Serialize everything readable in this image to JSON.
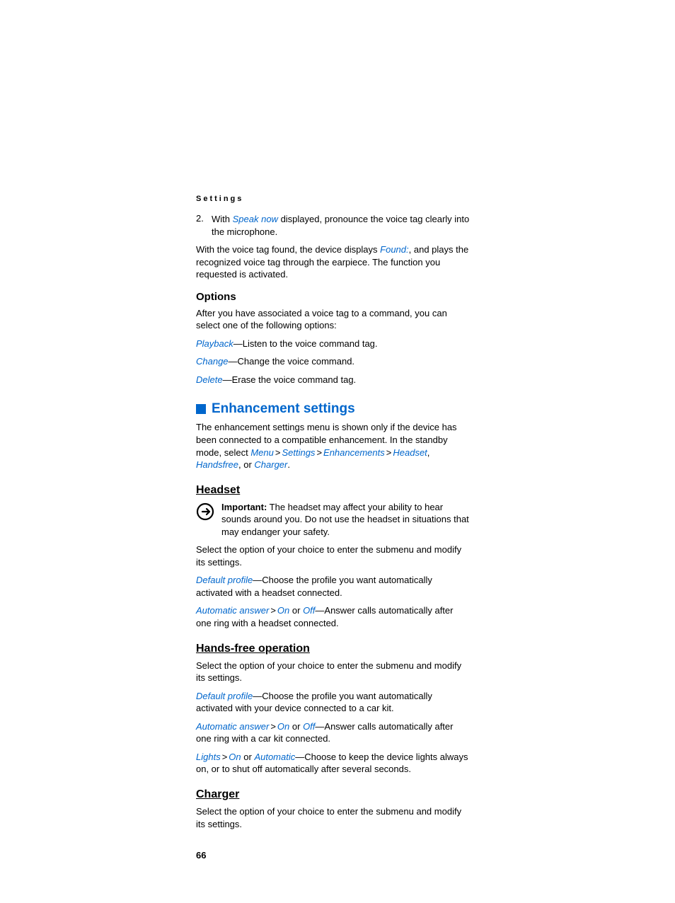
{
  "runhead": "Settings",
  "step2": {
    "num": "2.",
    "t1": "With ",
    "speak_now": "Speak now",
    "t2": " displayed, pronounce the voice tag clearly into the microphone."
  },
  "para_found": {
    "t1": "With the voice tag found, the device displays ",
    "found": "Found:",
    "t2": ", and plays the recognized voice tag through the earpiece. The function you requested is activated."
  },
  "options_h": "Options",
  "options_intro": "After you have associated a voice tag to a command, you can select one of the following options:",
  "opt_playback": {
    "term": "Playback",
    "desc": "—Listen to the voice command tag."
  },
  "opt_change": {
    "term": "Change",
    "desc": "—Change the voice command."
  },
  "opt_delete": {
    "term": "Delete",
    "desc": "—Erase the voice command tag."
  },
  "enh_title": "Enhancement settings",
  "enh_intro": {
    "t1": "The enhancement settings menu is shown only if the device has been connected to a compatible enhancement. In the standby mode, select ",
    "menu": "Menu",
    "gt": ">",
    "settings": "Settings",
    "enhancements": "Enhancements",
    "headset": "Headset",
    "handsfree": "Handsfree",
    "or": ", or ",
    "charger": "Charger",
    "period": "."
  },
  "headset_h": "Headset",
  "important": {
    "label": "Important:",
    "text": " The headset may affect your ability to hear sounds around you. Do not use the headset in situations that may endanger your safety."
  },
  "headset_select": "Select the option of your choice to enter the submenu and modify its settings.",
  "headset_def": {
    "term": "Default profile",
    "desc": "—Choose the profile you want automatically activated with a headset connected."
  },
  "headset_auto": {
    "term": "Automatic answer",
    "gt": ">",
    "on": "On",
    "or": " or ",
    "off": "Off",
    "desc": "—Answer calls automatically after one ring with a headset connected."
  },
  "hands_h": "Hands-free operation",
  "hands_select": "Select the option of your choice to enter the submenu and modify its settings.",
  "hands_def": {
    "term": "Default profile",
    "desc": "—Choose the profile you want automatically activated with your device connected to a car kit."
  },
  "hands_auto": {
    "term": "Automatic answer",
    "gt": ">",
    "on": "On",
    "or": " or ",
    "off": "Off",
    "desc": "—Answer calls automatically after one ring with a car kit connected."
  },
  "hands_lights": {
    "term": "Lights",
    "gt": ">",
    "on": "On",
    "or": " or ",
    "auto": "Automatic",
    "desc": "—Choose to keep the device lights always on, or to shut off automatically after several seconds."
  },
  "charger_h": "Charger",
  "charger_select": "Select the option of your choice to enter the submenu and modify its settings.",
  "page_number": "66"
}
